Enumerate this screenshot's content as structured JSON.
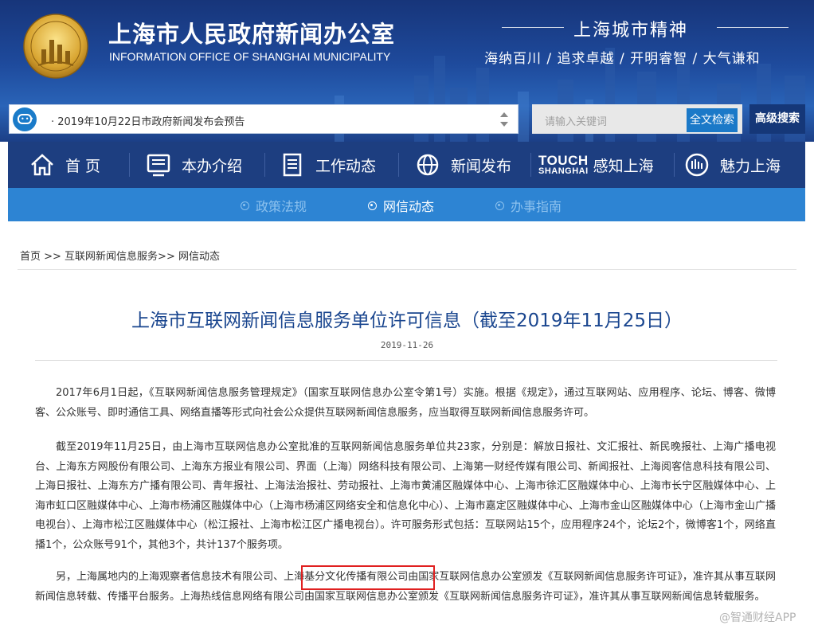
{
  "header": {
    "title_cn": "上海市人民政府新闻办公室",
    "title_en": "INFORMATION OFFICE OF SHANGHAI MUNICIPALITY",
    "spirit_title": "上海城市精神",
    "spirit_motto": "海纳百川 / 追求卓越 / 开明睿智 / 大气谦和"
  },
  "search": {
    "notice": "· 2019年10月22日市政府新闻发布会预告",
    "placeholder": "请输入关键词",
    "fulltext_label": "全文检索",
    "advanced_label": "高级搜索"
  },
  "main_nav": {
    "items": [
      {
        "label": "首 页",
        "icon": "home-icon"
      },
      {
        "label": "本办介绍",
        "icon": "monitor-icon"
      },
      {
        "label": "工作动态",
        "icon": "document-icon"
      },
      {
        "label": "新闻发布",
        "icon": "globe-icon"
      },
      {
        "label": "感知上海",
        "icon": "touch-logo",
        "logo_line1": "TOUCH",
        "logo_line2": "SHANGHAI"
      },
      {
        "label": "魅力上海",
        "icon": "emblem-icon"
      }
    ]
  },
  "sub_nav": {
    "items": [
      {
        "label": "政策法规",
        "active": false
      },
      {
        "label": "网信动态",
        "active": true
      },
      {
        "label": "办事指南",
        "active": false
      }
    ]
  },
  "breadcrumb": "首页 >> 互联网新闻信息服务>> 网信动态",
  "article": {
    "title": "上海市互联网新闻信息服务单位许可信息（截至2019年11月25日）",
    "date": "2019-11-26",
    "paragraphs": [
      "2017年6月1日起，《互联网新闻信息服务管理规定》（国家互联网信息办公室令第1号）实施。根据《规定》，通过互联网站、应用程序、论坛、博客、微博客、公众账号、即时通信工具、网络直播等形式向社会公众提供互联网新闻信息服务，应当取得互联网新闻信息服务许可。",
      "截至2019年11月25日，由上海市互联网信息办公室批准的互联网新闻信息服务单位共23家，分别是：解放日报社、文汇报社、新民晚报社、上海广播电视台、上海东方网股份有限公司、上海东方报业有限公司、界面（上海）网络科技有限公司、上海第一财经传媒有限公司、新闻报社、上海阅客信息科技有限公司、上海日报社、上海东方广播有限公司、青年报社、上海法治报社、劳动报社、上海市黄浦区融媒体中心、上海市徐汇区融媒体中心、上海市长宁区融媒体中心、上海市虹口区融媒体中心、上海市杨浦区融媒体中心（上海市杨浦区网络安全和信息化中心）、上海市嘉定区融媒体中心、上海市金山区融媒体中心（上海市金山广播电视台）、上海市松江区融媒体中心（松江报社、上海市松江区广播电视台）。许可服务形式包括：互联网站15个，应用程序24个，论坛2个，微博客1个，网络直播1个，公众账号91个，其他3个，共计137个服务项。",
      "另，上海属地内的上海观察者信息技术有限公司、上海基分文化传播有限公司由国家互联网信息办公室颁发《互联网新闻信息服务许可证》，准许其从事互联网新闻信息转载、传播平台服务。上海热线信息网络有限公司由国家互联网信息办公室颁发《互联网新闻信息服务许可证》，准许其从事互联网新闻信息转载服务。"
    ]
  },
  "watermark": "@智通财经APP",
  "colors": {
    "header_bg": "#1e4a9c",
    "nav_bg": "#1d3e80",
    "subnav_bg": "#2d84d3",
    "title_blue": "#1a468f",
    "highlight_red": "#e02020"
  }
}
